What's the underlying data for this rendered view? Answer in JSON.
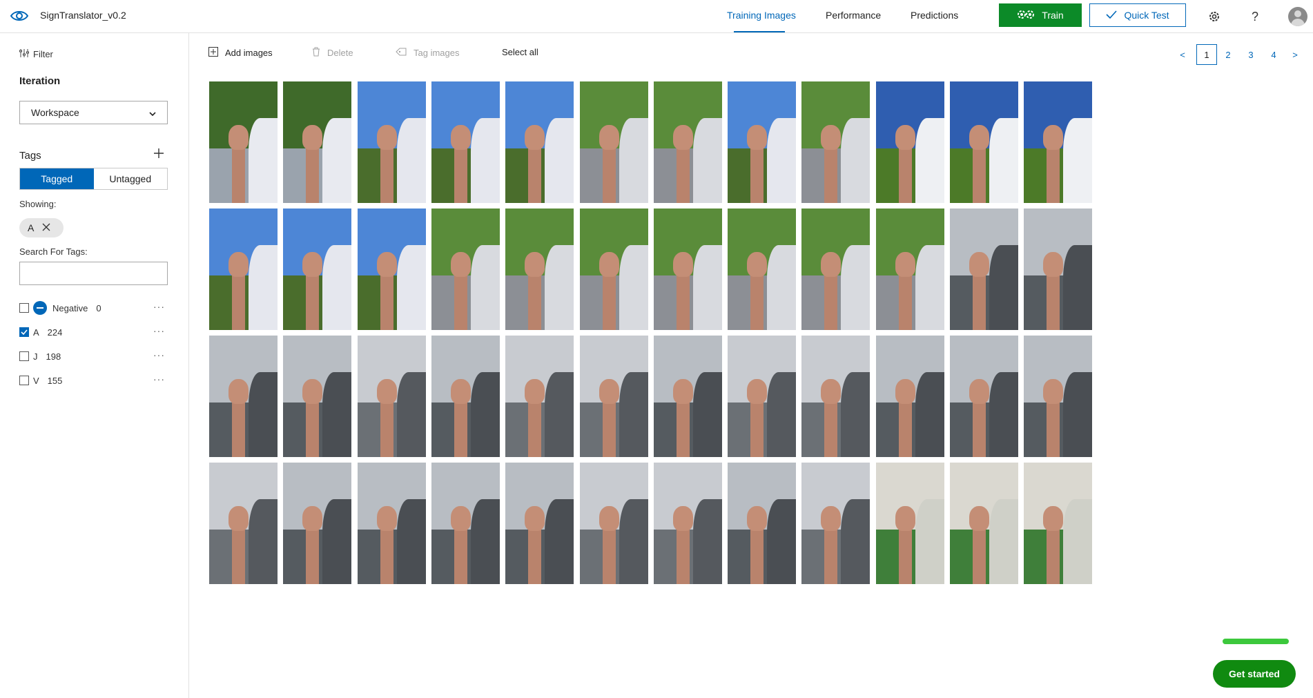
{
  "header": {
    "app_title": "SignTranslator_v0.2",
    "tabs": [
      {
        "label": "Training Images",
        "active": true
      },
      {
        "label": "Performance",
        "active": false
      },
      {
        "label": "Predictions",
        "active": false
      }
    ],
    "train_label": "Train",
    "quick_test_label": "Quick Test",
    "settings_icon": "gear-icon",
    "help_icon": "question-icon",
    "avatar_icon": "user-avatar-icon"
  },
  "sidebar": {
    "filter_label": "Filter",
    "iteration_label": "Iteration",
    "iteration_value": "Workspace",
    "tags_label": "Tags",
    "segment": {
      "tagged": "Tagged",
      "untagged": "Untagged",
      "selected": "Tagged"
    },
    "showing_label": "Showing:",
    "showing_chip": "A",
    "search_label": "Search For Tags:",
    "search_value": "",
    "tags": [
      {
        "name": "Negative",
        "count": "0",
        "checked": false,
        "negative": true
      },
      {
        "name": "A",
        "count": "224",
        "checked": true,
        "negative": false
      },
      {
        "name": "J",
        "count": "198",
        "checked": false,
        "negative": false
      },
      {
        "name": "V",
        "count": "155",
        "checked": false,
        "negative": false
      }
    ]
  },
  "toolbar": {
    "add_images": "Add images",
    "delete": "Delete",
    "tag_images": "Tag images",
    "select_all": "Select all"
  },
  "pagination": {
    "prev": "<",
    "pages": [
      "1",
      "2",
      "3",
      "4"
    ],
    "current": "1",
    "next": ">"
  },
  "thumbnails": {
    "partial_row_tones": [
      "skin",
      "skin",
      "dark",
      "dark",
      "skin",
      "skin",
      "dark"
    ],
    "rows": [
      [
        "park",
        "park",
        "sky",
        "sky",
        "sky",
        "tree",
        "tree",
        "sky",
        "tree",
        "sun",
        "sun",
        "sun"
      ],
      [
        "sky",
        "sky",
        "sky",
        "tree",
        "tree",
        "tree",
        "tree",
        "tree",
        "tree",
        "tree",
        "grey",
        "grey"
      ],
      [
        "grey",
        "grey",
        "building",
        "grey",
        "building",
        "building",
        "grey",
        "building",
        "building",
        "grey",
        "grey",
        "grey"
      ],
      [
        "building",
        "grey",
        "grey",
        "grey",
        "grey",
        "building",
        "building",
        "grey",
        "building",
        "indoor",
        "indoor",
        "indoor"
      ]
    ]
  },
  "get_started_label": "Get started",
  "colors": {
    "accent": "#0067b8",
    "train": "#0c8a28",
    "get_started": "#108a10"
  }
}
